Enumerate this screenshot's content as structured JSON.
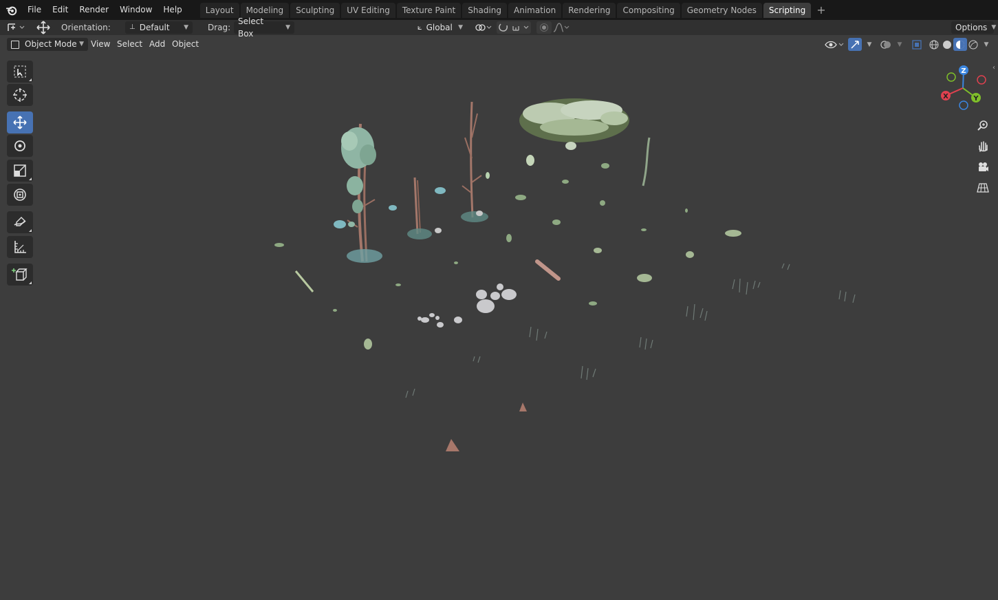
{
  "topbar": {
    "menus": [
      "File",
      "Edit",
      "Render",
      "Window",
      "Help"
    ],
    "workspace_tabs": [
      "Layout",
      "Modeling",
      "Sculpting",
      "UV Editing",
      "Texture Paint",
      "Shading",
      "Animation",
      "Rendering",
      "Compositing",
      "Geometry Nodes",
      "Scripting"
    ],
    "active_tab": "Scripting"
  },
  "toolheader": {
    "orientation_label": "Orientation:",
    "orientation_value": "Default",
    "drag_label": "Drag:",
    "drag_value": "Select Box",
    "transform_space": "Global",
    "options_label": "Options"
  },
  "viewport_header": {
    "mode": "Object Mode",
    "menus": [
      "View",
      "Select",
      "Add",
      "Object"
    ]
  },
  "gizmo": {
    "axes": [
      "Z",
      "X",
      "Y"
    ],
    "colors": {
      "x": "#e0414f",
      "y": "#7fbf2a",
      "z": "#3b86e0"
    }
  },
  "colors": {
    "background": "#3d3d3d",
    "accent": "#4772b3",
    "menubar": "#181818"
  }
}
